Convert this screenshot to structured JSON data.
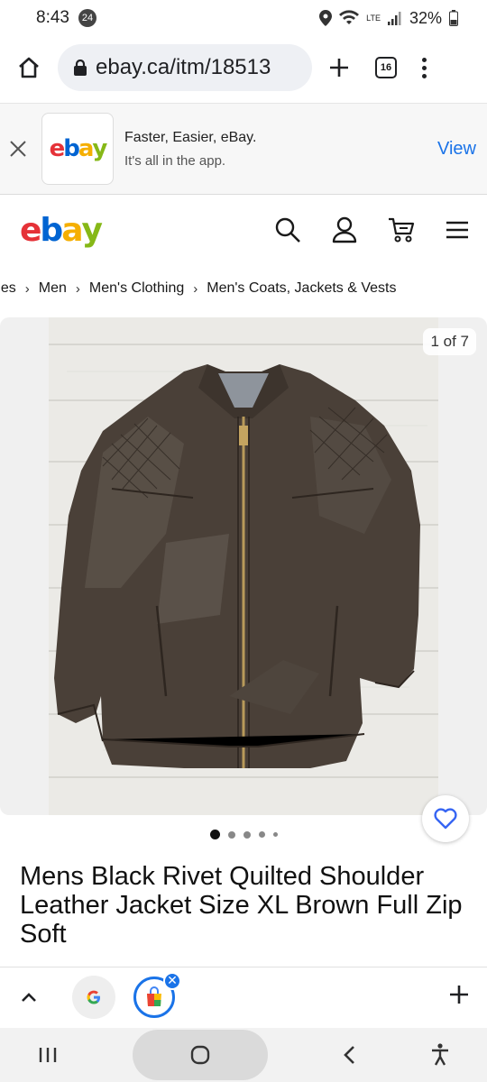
{
  "status_bar": {
    "time": "8:43",
    "notification_count": "24",
    "network": "LTE",
    "battery": "32%"
  },
  "browser": {
    "url": "ebay.ca/itm/18513",
    "tab_count": "16"
  },
  "app_banner": {
    "title": "Faster, Easier, eBay.",
    "subtitle": "It's all in the app.",
    "view_label": "View"
  },
  "logo": {
    "letters": [
      "e",
      "b",
      "a",
      "y"
    ]
  },
  "breadcrumb": [
    "ries",
    "Men",
    "Men's Clothing",
    "Men's Coats, Jackets & Vests"
  ],
  "gallery": {
    "counter": "1 of 7",
    "image_count": 7,
    "current_index": 1
  },
  "listing": {
    "title": "Mens Black Rivet Quilted Shoulder Leather Jacket Size XL Brown Full Zip Soft"
  },
  "colors": {
    "ebay_red": "#e53238",
    "ebay_blue": "#0064d2",
    "ebay_yellow": "#f5af02",
    "ebay_green": "#86b817",
    "link_blue": "#1a73e8"
  },
  "icons": [
    "home-icon",
    "lock-icon",
    "plus-icon",
    "tab-count",
    "menu-icon",
    "close-icon",
    "search-icon",
    "account-icon",
    "cart-icon",
    "hamburger-icon",
    "heart-icon",
    "chevron-up-icon",
    "google-icon",
    "shopping-bag-icon"
  ]
}
